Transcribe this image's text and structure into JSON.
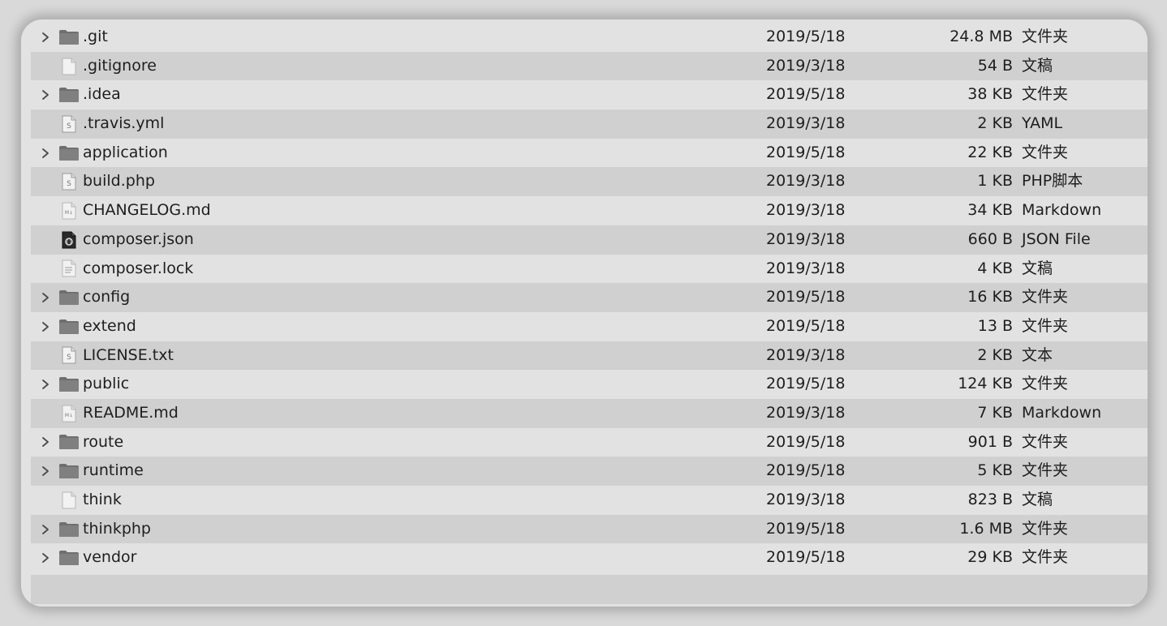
{
  "files": [
    {
      "name": ".git",
      "date": "2019/5/18",
      "size": "24.8 MB",
      "kind": "文件夹",
      "icon": "folder-icon",
      "expandable": true
    },
    {
      "name": ".gitignore",
      "date": "2019/3/18",
      "size": "54 B",
      "kind": "文稿",
      "icon": "blank-document-icon",
      "expandable": false
    },
    {
      "name": ".idea",
      "date": "2019/5/18",
      "size": "38 KB",
      "kind": "文件夹",
      "icon": "folder-icon",
      "expandable": true
    },
    {
      "name": ".travis.yml",
      "date": "2019/3/18",
      "size": "2 KB",
      "kind": "YAML",
      "icon": "script-document-icon",
      "expandable": false
    },
    {
      "name": "application",
      "date": "2019/5/18",
      "size": "22 KB",
      "kind": "文件夹",
      "icon": "folder-icon",
      "expandable": true
    },
    {
      "name": "build.php",
      "date": "2019/3/18",
      "size": "1 KB",
      "kind": "PHP脚本",
      "icon": "script-document-icon",
      "expandable": false
    },
    {
      "name": "CHANGELOG.md",
      "date": "2019/3/18",
      "size": "34 KB",
      "kind": "Markdown",
      "icon": "markdown-document-icon",
      "expandable": false
    },
    {
      "name": "composer.json",
      "date": "2019/3/18",
      "size": "660 B",
      "kind": "JSON File",
      "icon": "json-document-icon",
      "expandable": false
    },
    {
      "name": "composer.lock",
      "date": "2019/3/18",
      "size": "4 KB",
      "kind": "文稿",
      "icon": "text-document-icon",
      "expandable": false
    },
    {
      "name": "config",
      "date": "2019/5/18",
      "size": "16 KB",
      "kind": "文件夹",
      "icon": "folder-icon",
      "expandable": true
    },
    {
      "name": "extend",
      "date": "2019/5/18",
      "size": "13 B",
      "kind": "文件夹",
      "icon": "folder-icon",
      "expandable": true
    },
    {
      "name": "LICENSE.txt",
      "date": "2019/3/18",
      "size": "2 KB",
      "kind": "文本",
      "icon": "script-document-icon",
      "expandable": false
    },
    {
      "name": "public",
      "date": "2019/5/18",
      "size": "124 KB",
      "kind": "文件夹",
      "icon": "folder-icon",
      "expandable": true
    },
    {
      "name": "README.md",
      "date": "2019/3/18",
      "size": "7 KB",
      "kind": "Markdown",
      "icon": "markdown-document-icon",
      "expandable": false
    },
    {
      "name": "route",
      "date": "2019/5/18",
      "size": "901 B",
      "kind": "文件夹",
      "icon": "folder-icon",
      "expandable": true
    },
    {
      "name": "runtime",
      "date": "2019/5/18",
      "size": "5 KB",
      "kind": "文件夹",
      "icon": "folder-icon",
      "expandable": true
    },
    {
      "name": "think",
      "date": "2019/3/18",
      "size": "823 B",
      "kind": "文稿",
      "icon": "blank-document-icon",
      "expandable": false
    },
    {
      "name": "thinkphp",
      "date": "2019/5/18",
      "size": "1.6 MB",
      "kind": "文件夹",
      "icon": "folder-icon",
      "expandable": true
    },
    {
      "name": "vendor",
      "date": "2019/5/18",
      "size": "29 KB",
      "kind": "文件夹",
      "icon": "folder-icon",
      "expandable": true
    }
  ],
  "colors": {
    "window_bg": "#e2e2e2",
    "stripe_bg": "#d0d0d0",
    "text": "#1e1e1e"
  }
}
